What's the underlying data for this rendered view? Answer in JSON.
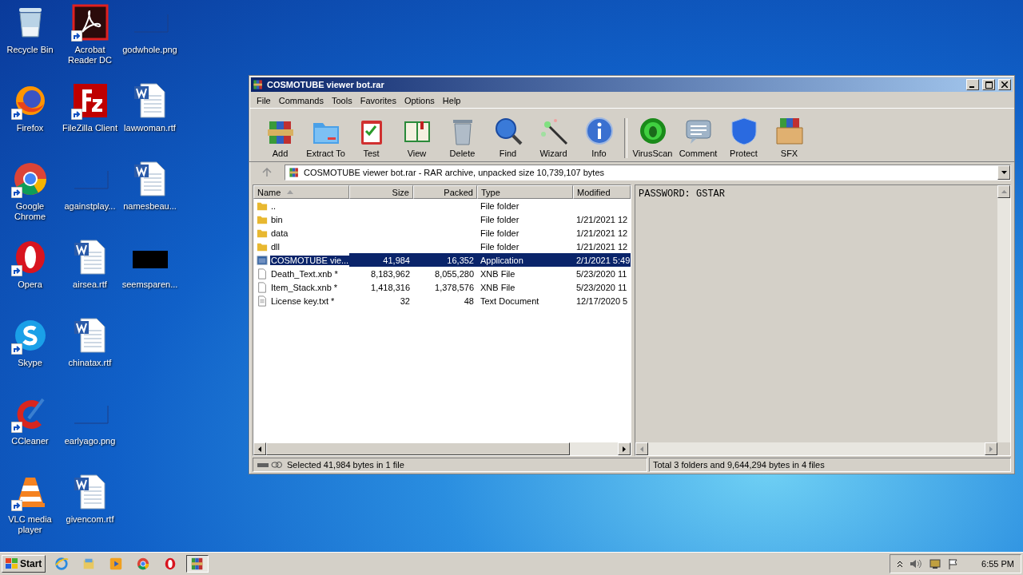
{
  "desktop": {
    "icons": [
      {
        "label": "Recycle Bin",
        "kind": "recycle",
        "shortcut": false
      },
      {
        "label": "Firefox",
        "kind": "firefox",
        "shortcut": true
      },
      {
        "label": "Google Chrome",
        "kind": "chrome",
        "shortcut": true
      },
      {
        "label": "Opera",
        "kind": "opera",
        "shortcut": true
      },
      {
        "label": "Skype",
        "kind": "skype",
        "shortcut": true
      },
      {
        "label": "CCleaner",
        "kind": "ccleaner",
        "shortcut": true
      },
      {
        "label": "VLC media player",
        "kind": "vlc",
        "shortcut": true
      },
      {
        "label": "Acrobat Reader DC",
        "kind": "acrobat",
        "shortcut": true
      },
      {
        "label": "FileZilla Client",
        "kind": "filezilla",
        "shortcut": true
      },
      {
        "label": "againstplay...",
        "kind": "blank",
        "shortcut": false
      },
      {
        "label": "airsea.rtf",
        "kind": "word",
        "shortcut": false
      },
      {
        "label": "chinatax.rtf",
        "kind": "word",
        "shortcut": false
      },
      {
        "label": "earlyago.png",
        "kind": "blank",
        "shortcut": false
      },
      {
        "label": "givencom.rtf",
        "kind": "word",
        "shortcut": false
      },
      {
        "label": "godwhole.png",
        "kind": "blank",
        "shortcut": false
      },
      {
        "label": "lawwoman.rtf",
        "kind": "word",
        "shortcut": false
      },
      {
        "label": "namesbeau...",
        "kind": "word",
        "shortcut": false
      },
      {
        "label": "seemsparen...",
        "kind": "black",
        "shortcut": false
      }
    ]
  },
  "window": {
    "title": "COSMOTUBE viewer bot.rar",
    "menu": [
      "File",
      "Commands",
      "Tools",
      "Favorites",
      "Options",
      "Help"
    ],
    "toolbar": [
      {
        "label": "Add",
        "kind": "books"
      },
      {
        "label": "Extract To",
        "kind": "folder"
      },
      {
        "label": "Test",
        "kind": "clipboard"
      },
      {
        "label": "View",
        "kind": "book"
      },
      {
        "label": "Delete",
        "kind": "bin"
      },
      {
        "label": "Find",
        "kind": "magnifier"
      },
      {
        "label": "Wizard",
        "kind": "wand"
      },
      {
        "label": "Info",
        "kind": "info"
      },
      {
        "label": "VirusScan",
        "kind": "bug"
      },
      {
        "label": "Comment",
        "kind": "comment"
      },
      {
        "label": "Protect",
        "kind": "shield"
      },
      {
        "label": "SFX",
        "kind": "box"
      }
    ],
    "path": "COSMOTUBE viewer bot.rar - RAR archive, unpacked size 10,739,107 bytes",
    "columns": [
      "Name",
      "Size",
      "Packed",
      "Type",
      "Modified"
    ],
    "files": [
      {
        "name": "..",
        "type": "File folder",
        "kind": "folder",
        "selected": false
      },
      {
        "name": "bin",
        "type": "File folder",
        "modified": "1/21/2021 12",
        "kind": "folder",
        "selected": false
      },
      {
        "name": "data",
        "type": "File folder",
        "modified": "1/21/2021 12",
        "kind": "folder",
        "selected": false
      },
      {
        "name": "dll",
        "type": "File folder",
        "modified": "1/21/2021 12",
        "kind": "folder",
        "selected": false
      },
      {
        "name": "COSMOTUBE vie...",
        "size": "41,984",
        "packed": "16,352",
        "type": "Application",
        "modified": "2/1/2021 5:49",
        "kind": "app",
        "selected": true
      },
      {
        "name": "Death_Text.xnb *",
        "size": "8,183,962",
        "packed": "8,055,280",
        "type": "XNB File",
        "modified": "5/23/2020 11",
        "kind": "file",
        "selected": false
      },
      {
        "name": "Item_Stack.xnb *",
        "size": "1,418,316",
        "packed": "1,378,576",
        "type": "XNB File",
        "modified": "5/23/2020 11",
        "kind": "file",
        "selected": false
      },
      {
        "name": "License key.txt *",
        "size": "32",
        "packed": "48",
        "type": "Text Document",
        "modified": "12/17/2020 5",
        "kind": "text",
        "selected": false
      }
    ],
    "preview": "PASSWORD: GSTAR",
    "status_left": "Selected 41,984 bytes in 1 file",
    "status_right": "Total 3 folders and 9,644,294 bytes in 4 files"
  },
  "taskbar": {
    "start": "Start",
    "apps": [
      {
        "kind": "ie",
        "selected": false
      },
      {
        "kind": "explorer",
        "selected": false
      },
      {
        "kind": "media",
        "selected": false
      },
      {
        "kind": "chrome",
        "selected": false
      },
      {
        "kind": "opera",
        "selected": false
      },
      {
        "kind": "winrar",
        "selected": true
      }
    ],
    "clock": "6:55 PM"
  }
}
